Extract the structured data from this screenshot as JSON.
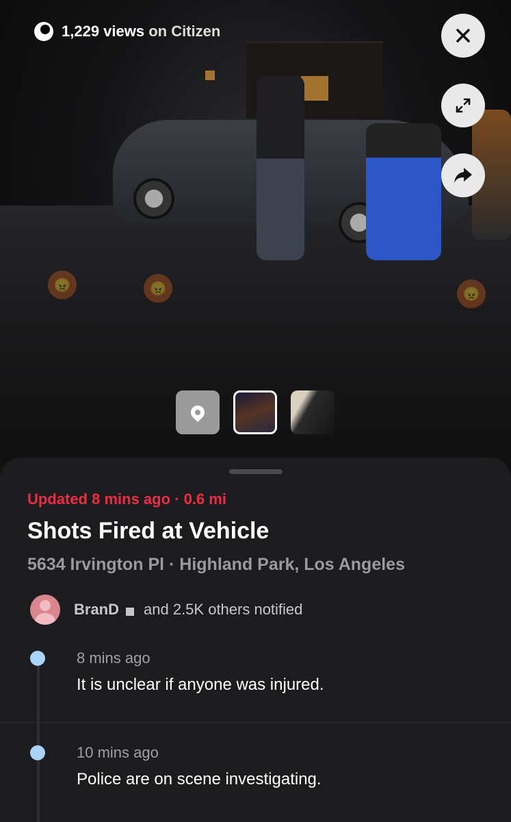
{
  "overlay": {
    "views": "1,229 views",
    "on_citizen": "on Citizen",
    "close_icon": "close-icon",
    "expand_icon": "expand-icon",
    "share_icon": "share-icon"
  },
  "thumbnails": [
    {
      "kind": "map",
      "icon": "location-pin-icon"
    },
    {
      "kind": "video",
      "selected": true
    },
    {
      "kind": "video",
      "selected": false
    }
  ],
  "incident": {
    "updated": "Updated 8 mins ago · 0.6 mi",
    "title": "Shots Fired at Vehicle",
    "address": "5634 Irvington Pl · Highland Park, Los Angeles",
    "notified_user": "BranD",
    "notified_others": "and 2.5K others notified"
  },
  "timeline": [
    {
      "time": "8 mins ago",
      "text": "It is unclear if anyone was injured."
    },
    {
      "time": "10 mins ago",
      "text": "Police are on scene investigating."
    }
  ],
  "colors": {
    "accent_red": "#ef2c44",
    "timeline_dot": "#a9d4f7",
    "sheet_bg": "#1c1c1e"
  }
}
